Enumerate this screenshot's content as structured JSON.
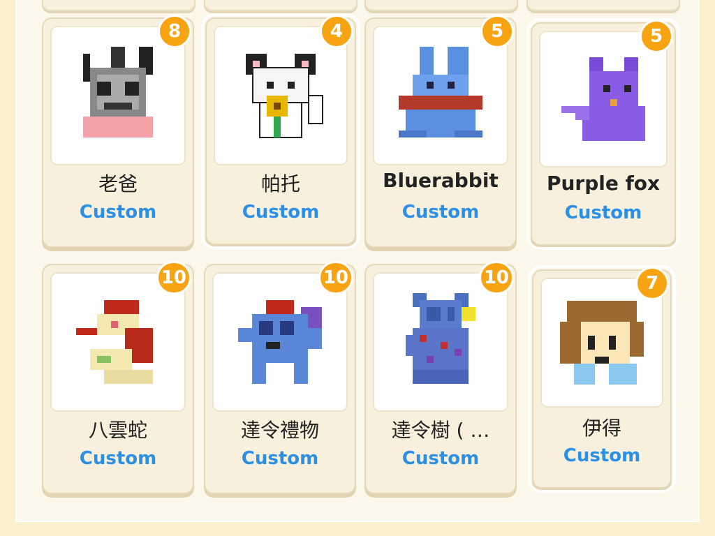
{
  "items": [
    {
      "name": "老爸",
      "badge": "8",
      "sub": "Custom",
      "icon": "pixel-grey-bunny-icon"
    },
    {
      "name": "帕托",
      "badge": "4",
      "sub": "Custom",
      "icon": "pixel-white-bear-sunflower-icon"
    },
    {
      "name": "Bluerabbit",
      "badge": "5",
      "sub": "Custom",
      "icon": "pixel-blue-rabbit-icon"
    },
    {
      "name": "Purple fox",
      "badge": "5",
      "sub": "Custom",
      "icon": "pixel-purple-fox-icon"
    },
    {
      "name": "八雲蛇",
      "badge": "10",
      "sub": "Custom",
      "icon": "pixel-santa-snake-icon"
    },
    {
      "name": "達令禮物",
      "badge": "10",
      "sub": "Custom",
      "icon": "pixel-blue-monster-gift-icon"
    },
    {
      "name": "達令樹 ( …",
      "badge": "10",
      "sub": "Custom",
      "icon": "pixel-blue-tree-monster-icon"
    },
    {
      "name": "伊得",
      "badge": "7",
      "sub": "Custom",
      "icon": "pixel-brown-hair-kid-icon"
    }
  ],
  "colors": {
    "badge": "#f7a312",
    "subtitle": "#2b8fe6",
    "background": "#fdf0cf"
  }
}
